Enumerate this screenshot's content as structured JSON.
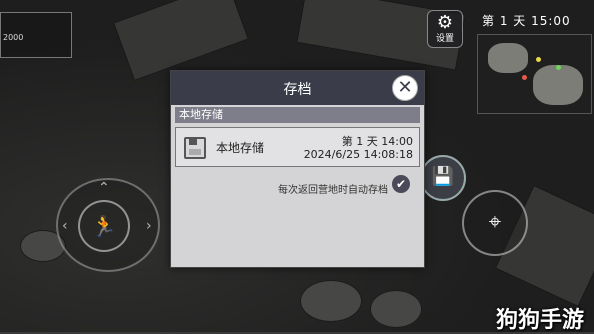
{
  "hud": {
    "top_left_number": "2000",
    "settings_label": "设置",
    "day_time": "第 1 天  15:00"
  },
  "dialog": {
    "title": "存档",
    "section_label": "本地存储",
    "slot": {
      "name": "本地存储",
      "day": "第 1 天  14:00",
      "datetime": "2024/6/25 14:08:18"
    },
    "autosave_label": "每次返回营地时自动存档",
    "autosave_checked": true
  },
  "watermark": "狗狗手游",
  "icons": {
    "close": "close-icon",
    "settings": "gear-icon",
    "save": "save-icon",
    "attack": "crosshair-icon",
    "sprint": "running-man-icon",
    "check": "check-icon"
  }
}
